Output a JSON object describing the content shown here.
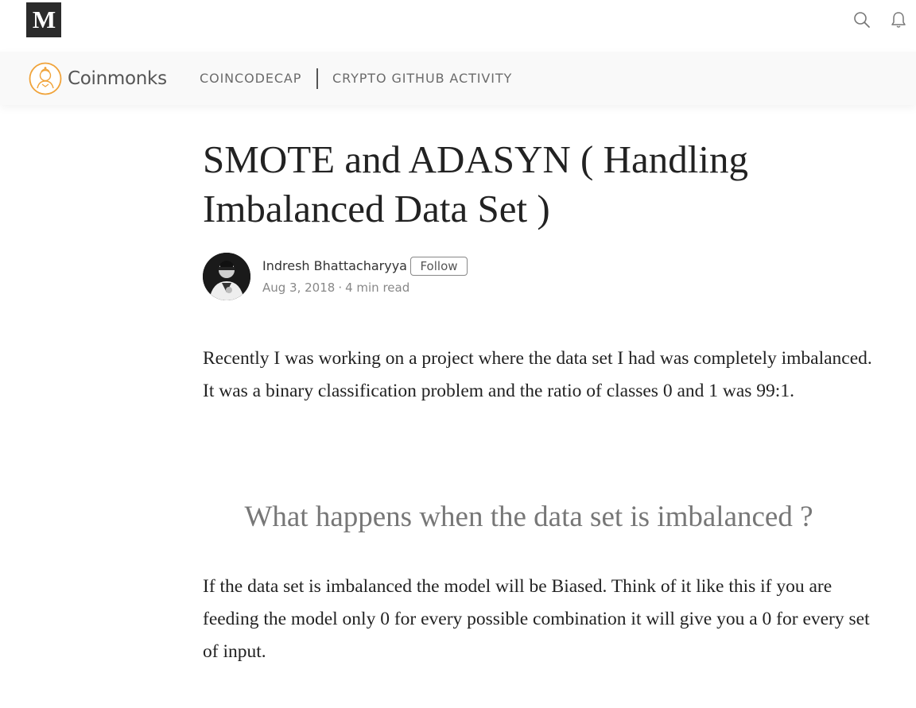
{
  "header": {
    "logo_letter": "M",
    "icons": [
      "search-icon",
      "bell-icon"
    ]
  },
  "publication": {
    "name": "Coinmonks",
    "links": [
      "COINCODECAP",
      "CRYPTO GITHUB ACTIVITY"
    ],
    "accent": "#f0a33a"
  },
  "article": {
    "title": "SMOTE and ADASYN ( Handling Imbalanced Data Set )",
    "author": "Indresh Bhattacharyya",
    "follow_label": "Follow",
    "date": "Aug 3, 2018",
    "separator": "·",
    "read_time": "4 min read",
    "paragraph1": "Recently I was working on a project where the data set I had was completely imbalanced. It was a binary classification problem and the ratio of classes 0 and 1 was 99:1.",
    "subheading": "What happens when the data set is imbalanced ?",
    "paragraph2": "If the data set is imbalanced the model will be Biased. Think of it like this if you are feeding the model only 0 for every possible combination it will give you a 0 for every set of input."
  }
}
